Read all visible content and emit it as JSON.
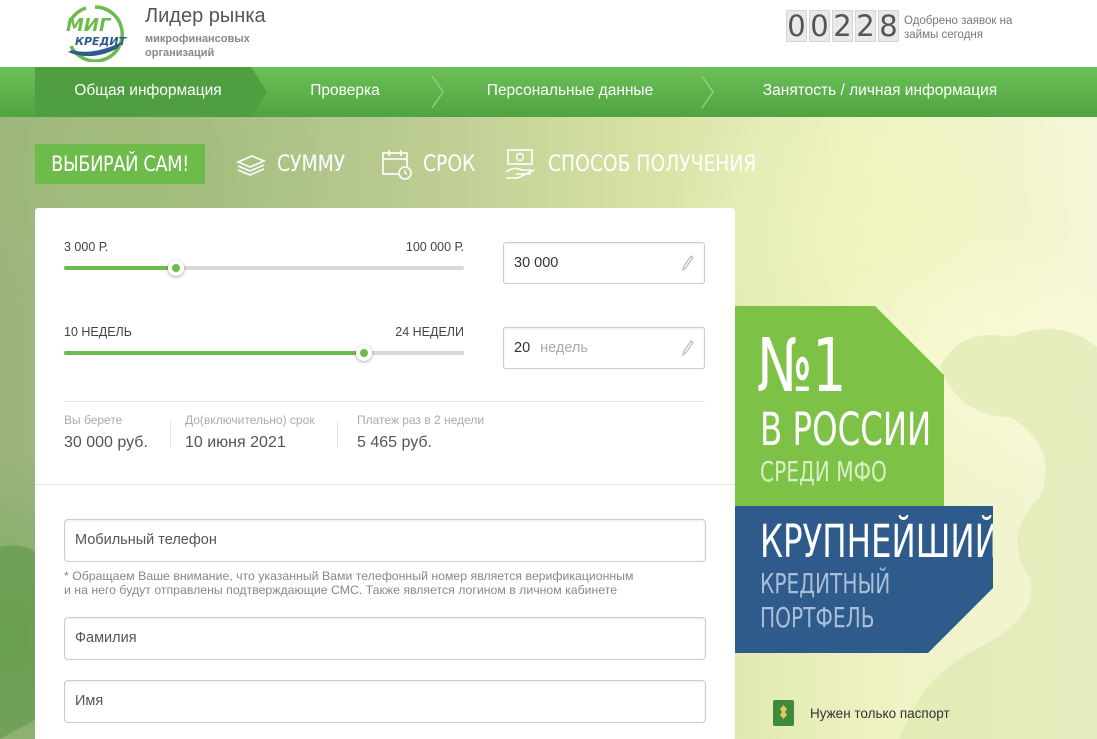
{
  "header": {
    "logo_top": "МИГ",
    "logo_bottom": "КРЕДИТ",
    "tagline_main": "Лидер рынка",
    "tagline_sub": "микрофинансовых организаций",
    "counter_digits": [
      "0",
      "0",
      "2",
      "2",
      "8"
    ],
    "counter_caption": "Одобрено заявок на займы сегодня"
  },
  "steps": [
    {
      "label": "Общая информация",
      "active": true
    },
    {
      "label": "Проверка",
      "active": false
    },
    {
      "label": "Персональные данные",
      "active": false
    },
    {
      "label": "Занятость / личная информация",
      "active": false
    }
  ],
  "choose": {
    "button": "ВЫБИРАЙ САМ!",
    "sum": "СУММУ",
    "term": "СРОК",
    "method": "СПОСОБ ПОЛУЧЕНИЯ"
  },
  "calculator": {
    "amount": {
      "min_label": "3 000 Р.",
      "max_label": "100 000 Р.",
      "value": "30 000",
      "fill_fraction": 0.28
    },
    "term": {
      "min_label": "10 НЕДЕЛЬ",
      "max_label": "24 НЕДЕЛИ",
      "value": "20",
      "unit": "недель",
      "fill_fraction": 0.75
    },
    "summary": [
      {
        "caption": "Вы берете",
        "value": "30 000 руб."
      },
      {
        "caption": "До(включительно) срок",
        "value": "10 июня 2021"
      },
      {
        "caption": "Платеж раз в 2 недели",
        "value": "5 465 руб."
      }
    ]
  },
  "form": {
    "phone_placeholder": "Мобильный телефон",
    "phone_note_1": "* Обращаем Ваше внимание, что указанный Вами телефонный номер является верификационным",
    "phone_note_2": "и на него будут отправлены подтверждающие СМС. Также является логином в личном кабинете",
    "lastname_placeholder": "Фамилия",
    "firstname_placeholder": "Имя"
  },
  "banners": {
    "number": "№1",
    "country": "В РОССИИ",
    "among": "СРЕДИ МФО",
    "largest": "КРУПНЕЙШИЙ",
    "credit": "КРЕДИТНЫЙ",
    "portfolio": "ПОРТФЕЛЬ",
    "passport_note": "Нужен только паспорт"
  },
  "colors": {
    "green": "#6dbb4a",
    "nav_green": "#5aae48",
    "blue": "#2e5a8c",
    "banner_green": "#7dc146"
  }
}
